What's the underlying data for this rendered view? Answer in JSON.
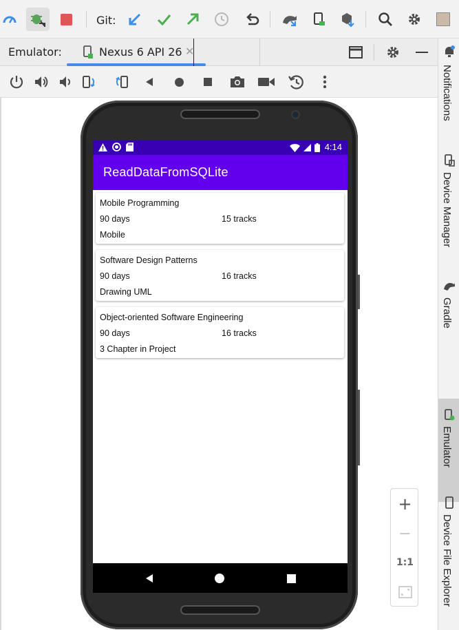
{
  "toolbar": {
    "git_label": "Git:"
  },
  "tabs": {
    "emulator_label": "Emulator:",
    "device_tab_label": "Nexus 6 API 26",
    "close_glyph": "✕"
  },
  "right_panel": {
    "items": [
      {
        "label": "Notifications"
      },
      {
        "label": "Device Manager"
      },
      {
        "label": "Gradle"
      },
      {
        "label": "Emulator"
      },
      {
        "label": "Device File Explorer"
      }
    ]
  },
  "zoom": {
    "zoom_in": "+",
    "zoom_out": "−",
    "actual_size": "1:1"
  },
  "device": {
    "status_time": "4:14",
    "app_title": "ReadDataFromSQLite",
    "courses": [
      {
        "name": "Mobile Programming",
        "duration": "90 days",
        "tracks": "15 tracks",
        "description": "Mobile"
      },
      {
        "name": "Software Design Patterns",
        "duration": "90 days",
        "tracks": "16 tracks",
        "description": "Drawing UML"
      },
      {
        "name": "Object-oriented Software Engineering",
        "duration": "90 days",
        "tracks": "16 tracks",
        "description": "3 Chapter in Project"
      }
    ]
  },
  "colors": {
    "status_bar": "#3700b3",
    "app_bar": "#6200ee",
    "tab_underline": "#4a88e5",
    "stop_red": "#e05555",
    "git_blue": "#3d8ee6",
    "git_green": "#4caf50"
  }
}
